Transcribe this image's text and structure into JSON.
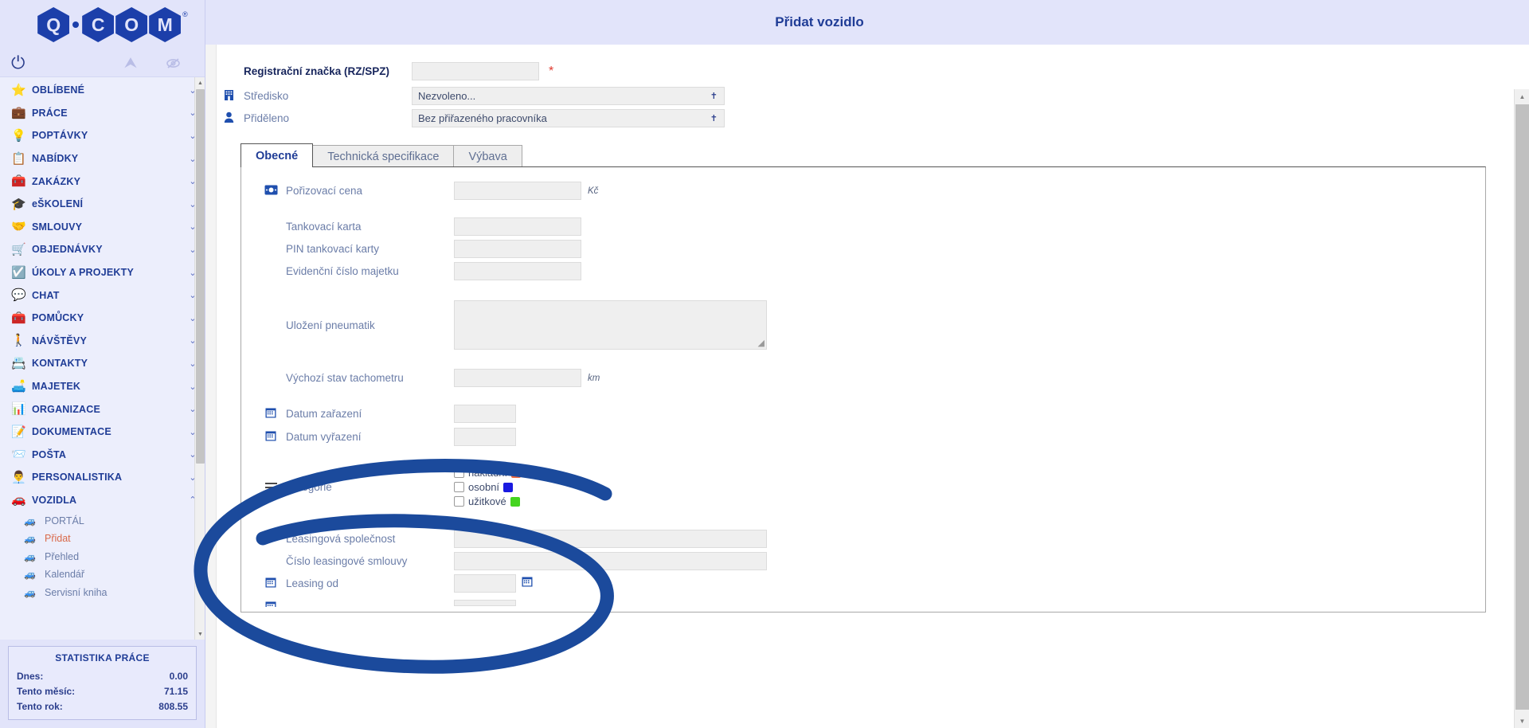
{
  "brand": {
    "logo_letters": [
      "Q",
      "C",
      "O",
      "M"
    ],
    "registered_mark": "®",
    "power_icon": "power-icon",
    "collapse_icon": "double-chevron-up-icon",
    "hide_icon": "eye-slash-icon"
  },
  "window": {
    "title": "Přidat vozidlo"
  },
  "sidebar": {
    "items": [
      {
        "label": "OBLÍBENÉ",
        "icon": "⭐",
        "icon_name": "star-icon",
        "chevron": "⌄"
      },
      {
        "label": "PRÁCE",
        "icon": "💼",
        "icon_name": "briefcase-icon",
        "chevron": "⌄"
      },
      {
        "label": "POPTÁVKY",
        "icon": "💡",
        "icon_name": "lightbulb-icon",
        "chevron": "⌄"
      },
      {
        "label": "NABÍDKY",
        "icon": "📋",
        "icon_name": "clipboard-icon",
        "chevron": "⌄"
      },
      {
        "label": "ZAKÁZKY",
        "icon": "🧰",
        "icon_name": "toolbox-icon",
        "chevron": "⌄"
      },
      {
        "label": "eŠKOLENÍ",
        "icon": "🎓",
        "icon_name": "graduation-cap-icon",
        "chevron": "⌄"
      },
      {
        "label": "SMLOUVY",
        "icon": "🤝",
        "icon_name": "handshake-icon",
        "chevron": "⌄"
      },
      {
        "label": "OBJEDNÁVKY",
        "icon": "🛒",
        "icon_name": "shopping-cart-icon",
        "chevron": "⌄"
      },
      {
        "label": "ÚKOLY A PROJEKTY",
        "icon": "☑️",
        "icon_name": "checkbox-task-icon",
        "chevron": "⌄"
      },
      {
        "label": "CHAT",
        "icon": "💬",
        "icon_name": "chat-bubble-icon",
        "chevron": "⌄"
      },
      {
        "label": "POMŮCKY",
        "icon": "🧰",
        "icon_name": "tools-icon",
        "chevron": "⌄"
      },
      {
        "label": "NÁVŠTĚVY",
        "icon": "🚶",
        "icon_name": "walking-person-icon",
        "chevron": "⌄"
      },
      {
        "label": "KONTAKTY",
        "icon": "📇",
        "icon_name": "contacts-card-icon",
        "chevron": "⌄"
      },
      {
        "label": "MAJETEK",
        "icon": "🛋️",
        "icon_name": "armchair-icon",
        "chevron": "⌄"
      },
      {
        "label": "ORGANIZACE",
        "icon": "📊",
        "icon_name": "org-chart-icon",
        "chevron": "⌄"
      },
      {
        "label": "DOKUMENTACE",
        "icon": "📝",
        "icon_name": "document-pen-icon",
        "chevron": "⌄"
      },
      {
        "label": "POŠTA",
        "icon": "📨",
        "icon_name": "envelope-icon",
        "chevron": "⌄"
      },
      {
        "label": "PERSONALISTIKA",
        "icon": "👨‍💼",
        "icon_name": "personnel-icon",
        "chevron": "⌄"
      },
      {
        "label": "VOZIDLA",
        "icon": "🚗",
        "icon_name": "car-icon",
        "chevron": "⌃"
      }
    ],
    "sub_items": [
      {
        "label": "PORTÁL",
        "icon": "🚙",
        "icon_name": "car-small-icon",
        "active": false
      },
      {
        "label": "Přidat",
        "icon": "🚙",
        "icon_name": "car-small-icon",
        "active": true
      },
      {
        "label": "Přehled",
        "icon": "🚙",
        "icon_name": "car-small-icon",
        "active": false
      },
      {
        "label": "Kalendář",
        "icon": "🚙",
        "icon_name": "car-small-icon",
        "active": false
      },
      {
        "label": "Servisní kniha",
        "icon": "🚙",
        "icon_name": "car-small-icon",
        "active": false
      }
    ],
    "stats": {
      "title": "STATISTIKA PRÁCE",
      "rows": [
        {
          "label": "Dnes:",
          "value": "0.00"
        },
        {
          "label": "Tento měsíc:",
          "value": "71.15"
        },
        {
          "label": "Tento rok:",
          "value": "808.55"
        }
      ]
    }
  },
  "form": {
    "header_fields": {
      "rz_label": "Registrační značka (RZ/SPZ)",
      "rz_value": "",
      "rz_required_mark": "*",
      "stredisko_label": "Středisko",
      "stredisko_value": "Nezvoleno...",
      "stredisko_icon": "building-icon",
      "prideleno_label": "Přiděleno",
      "prideleno_value": "Bez přiřazeného pracovníka",
      "prideleno_icon": "person-icon"
    },
    "tabs": [
      {
        "label": "Obecné",
        "selected": true
      },
      {
        "label": "Technická specifikace",
        "selected": false
      },
      {
        "label": "Výbava",
        "selected": false
      }
    ],
    "fields": {
      "porizovaci_cena_label": "Pořizovací cena",
      "porizovaci_cena_value": "",
      "porizovaci_cena_unit": "Kč",
      "porizovaci_cena_icon": "money-icon",
      "tankovaci_karta_label": "Tankovací karta",
      "tankovaci_karta_value": "",
      "pin_tankovaci_label": "PIN tankovací karty",
      "pin_tankovaci_value": "",
      "evidencni_cislo_label": "Evidenční číslo majetku",
      "evidencni_cislo_value": "",
      "ulozeni_pneumatik_label": "Uložení pneumatik",
      "ulozeni_pneumatik_value": "",
      "tachometr_label": "Výchozí stav tachometru",
      "tachometr_value": "",
      "tachometr_unit": "km",
      "datum_zarazeni_label": "Datum zařazení",
      "datum_zarazeni_value": "",
      "datum_vyrazeni_label": "Datum vyřazení",
      "datum_vyrazeni_value": "",
      "kategorie_label": "Kategorie",
      "kategorie_icon": "hamburger-list-icon",
      "leasing_spolecnost_label": "Leasingová společnost",
      "leasing_spolecnost_value": "",
      "cislo_leasing_label": "Číslo leasingové smlouvy",
      "cislo_leasing_value": "",
      "leasing_od_label": "Leasing od",
      "leasing_od_value": "",
      "calendar_icon": "calendar-icon"
    },
    "kategorie_options": [
      {
        "label": "nákladní",
        "color": "#f06a3c",
        "checked": false
      },
      {
        "label": "osobní",
        "color": "#1a1ae0",
        "checked": false
      },
      {
        "label": "užitkové",
        "color": "#44d41f",
        "checked": false
      }
    ]
  },
  "annotation": {
    "type": "hand-drawn-ellipse",
    "color": "#1b4a9c"
  }
}
